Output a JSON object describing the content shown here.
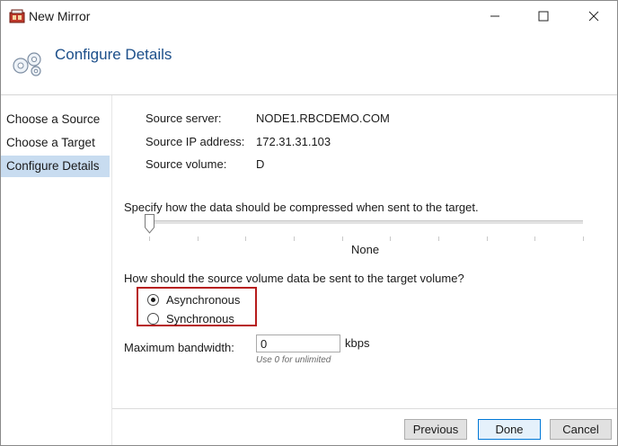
{
  "window": {
    "title": "New Mirror"
  },
  "header": {
    "title": "Configure Details"
  },
  "nav": {
    "items": [
      {
        "label": "Choose a Source",
        "active": false
      },
      {
        "label": "Choose a Target",
        "active": false
      },
      {
        "label": "Configure Details",
        "active": true
      }
    ]
  },
  "source": {
    "server_label": "Source server:",
    "server_value": "NODE1.RBCDEMO.COM",
    "ip_label": "Source IP address:",
    "ip_value": "172.31.31.103",
    "volume_label": "Source volume:",
    "volume_value": "D"
  },
  "compression": {
    "label": "Specify how the data should be compressed when sent to the target.",
    "value": "None",
    "level_index": 0,
    "tick_count": 10
  },
  "send_mode": {
    "label": "How should the source volume data be sent to the target volume?",
    "options": [
      {
        "label": "Asynchronous",
        "selected": true
      },
      {
        "label": "Synchronous",
        "selected": false
      }
    ]
  },
  "bandwidth": {
    "label": "Maximum bandwidth:",
    "value": "0",
    "unit": "kbps",
    "hint": "Use 0 for unlimited"
  },
  "buttons": {
    "previous": "Previous",
    "done": "Done",
    "cancel": "Cancel"
  },
  "icons": {
    "app": "mirror-app-icon",
    "header": "gears-icon",
    "minimize": "minimize-icon",
    "maximize": "maximize-icon",
    "close": "close-icon"
  },
  "colors": {
    "header_title": "#1c4f8a",
    "nav_active": "#c8dcf0",
    "highlight_box": "#b71c1c",
    "default_button_border": "#0078d7"
  }
}
